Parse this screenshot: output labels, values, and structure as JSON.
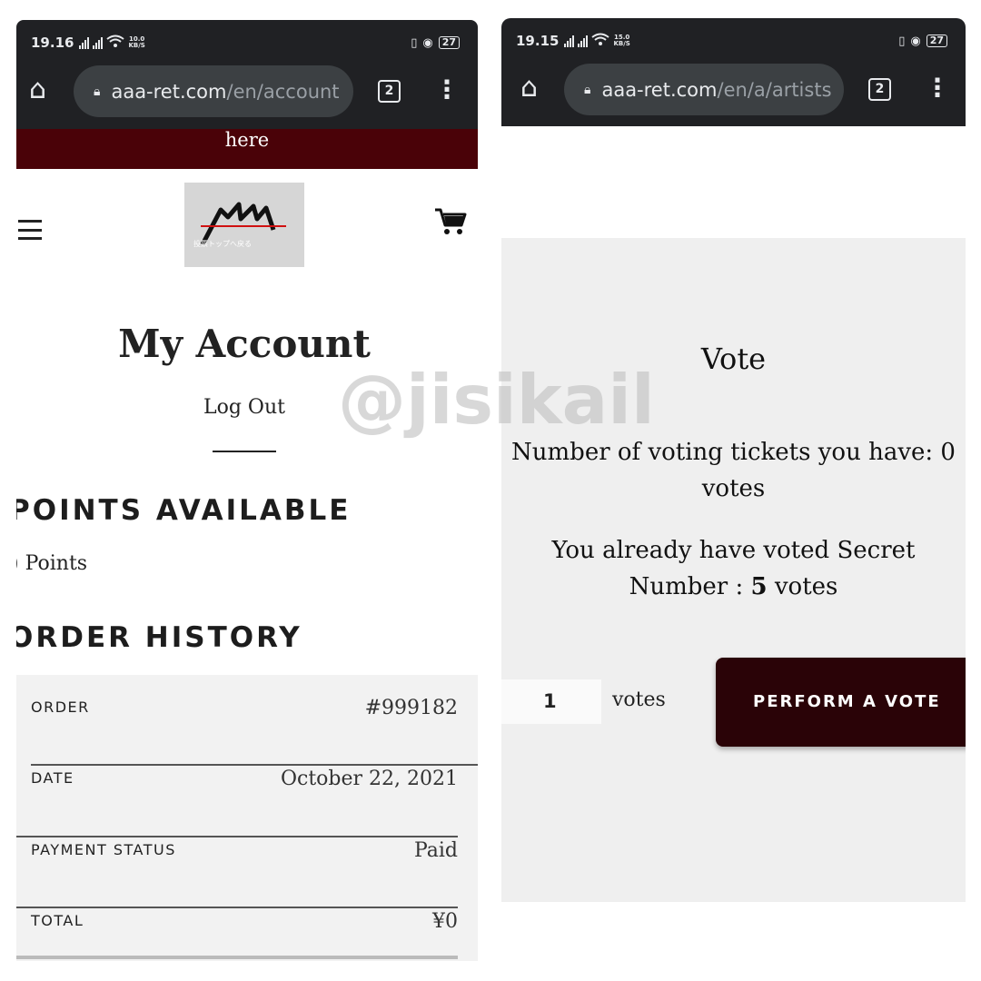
{
  "left": {
    "status": {
      "time": "19.16",
      "speed": "10.0",
      "speed_unit": "KB/S",
      "battery": "27"
    },
    "browser": {
      "url_host": "aaa-ret.com",
      "url_path": "/en/account",
      "tab_count": "2"
    },
    "banner_text": "here",
    "logo_text": "投票トップへ戻る",
    "page_title": "My Account",
    "logout_label": "Log Out",
    "points_heading": "POINTS AVAILABLE",
    "points_value": ") Points",
    "order_heading": "ORDER HISTORY",
    "order": [
      {
        "label": "ORDER",
        "value": "#999182"
      },
      {
        "label": "DATE",
        "value": "October 22, 2021"
      },
      {
        "label": "PAYMENT STATUS",
        "value": "Paid"
      },
      {
        "label": "TOTAL",
        "value": "¥0"
      }
    ]
  },
  "right": {
    "status": {
      "time": "19.15",
      "speed": "15.0",
      "speed_unit": "KB/S",
      "battery": "27"
    },
    "browser": {
      "url_host": "aaa-ret.com",
      "url_path": "/en/a/artists",
      "tab_count": "2"
    },
    "vote_title": "Vote",
    "tickets_line1": "Number of voting tickets you have: 0",
    "tickets_line2": "votes",
    "voted_line1": "You already have voted Secret",
    "voted_prefix": "Number : ",
    "voted_count": "5",
    "voted_suffix": " votes",
    "qty_value": "1",
    "votes_unit": "votes",
    "perform_label": "PERFORM A VOTE"
  },
  "watermark": "@jisikail",
  "colors": {
    "chrome": "#202124",
    "banner": "#4a0208",
    "button": "#2a0307"
  }
}
